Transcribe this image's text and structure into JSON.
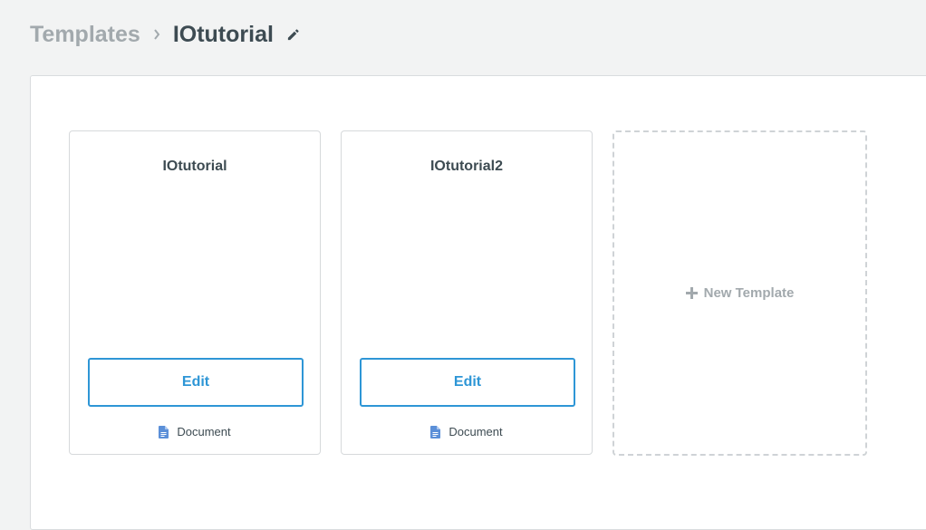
{
  "breadcrumb": {
    "root": "Templates",
    "current": "IOtutorial"
  },
  "templates": [
    {
      "title": "IOtutorial",
      "button_label": "Edit",
      "type": "Document"
    },
    {
      "title": "IOtutorial2",
      "button_label": "Edit",
      "type": "Document"
    }
  ],
  "new_template": {
    "label": "New Template"
  },
  "icons": {
    "separator": "chevron-right-icon",
    "edit_title": "pencil-icon",
    "document": "document-icon",
    "add": "plus-icon"
  },
  "colors": {
    "accent": "#2e96d6",
    "text_dark": "#3d4b52",
    "text_muted": "#a2a9ad",
    "document_icon": "#5b8fd8"
  }
}
